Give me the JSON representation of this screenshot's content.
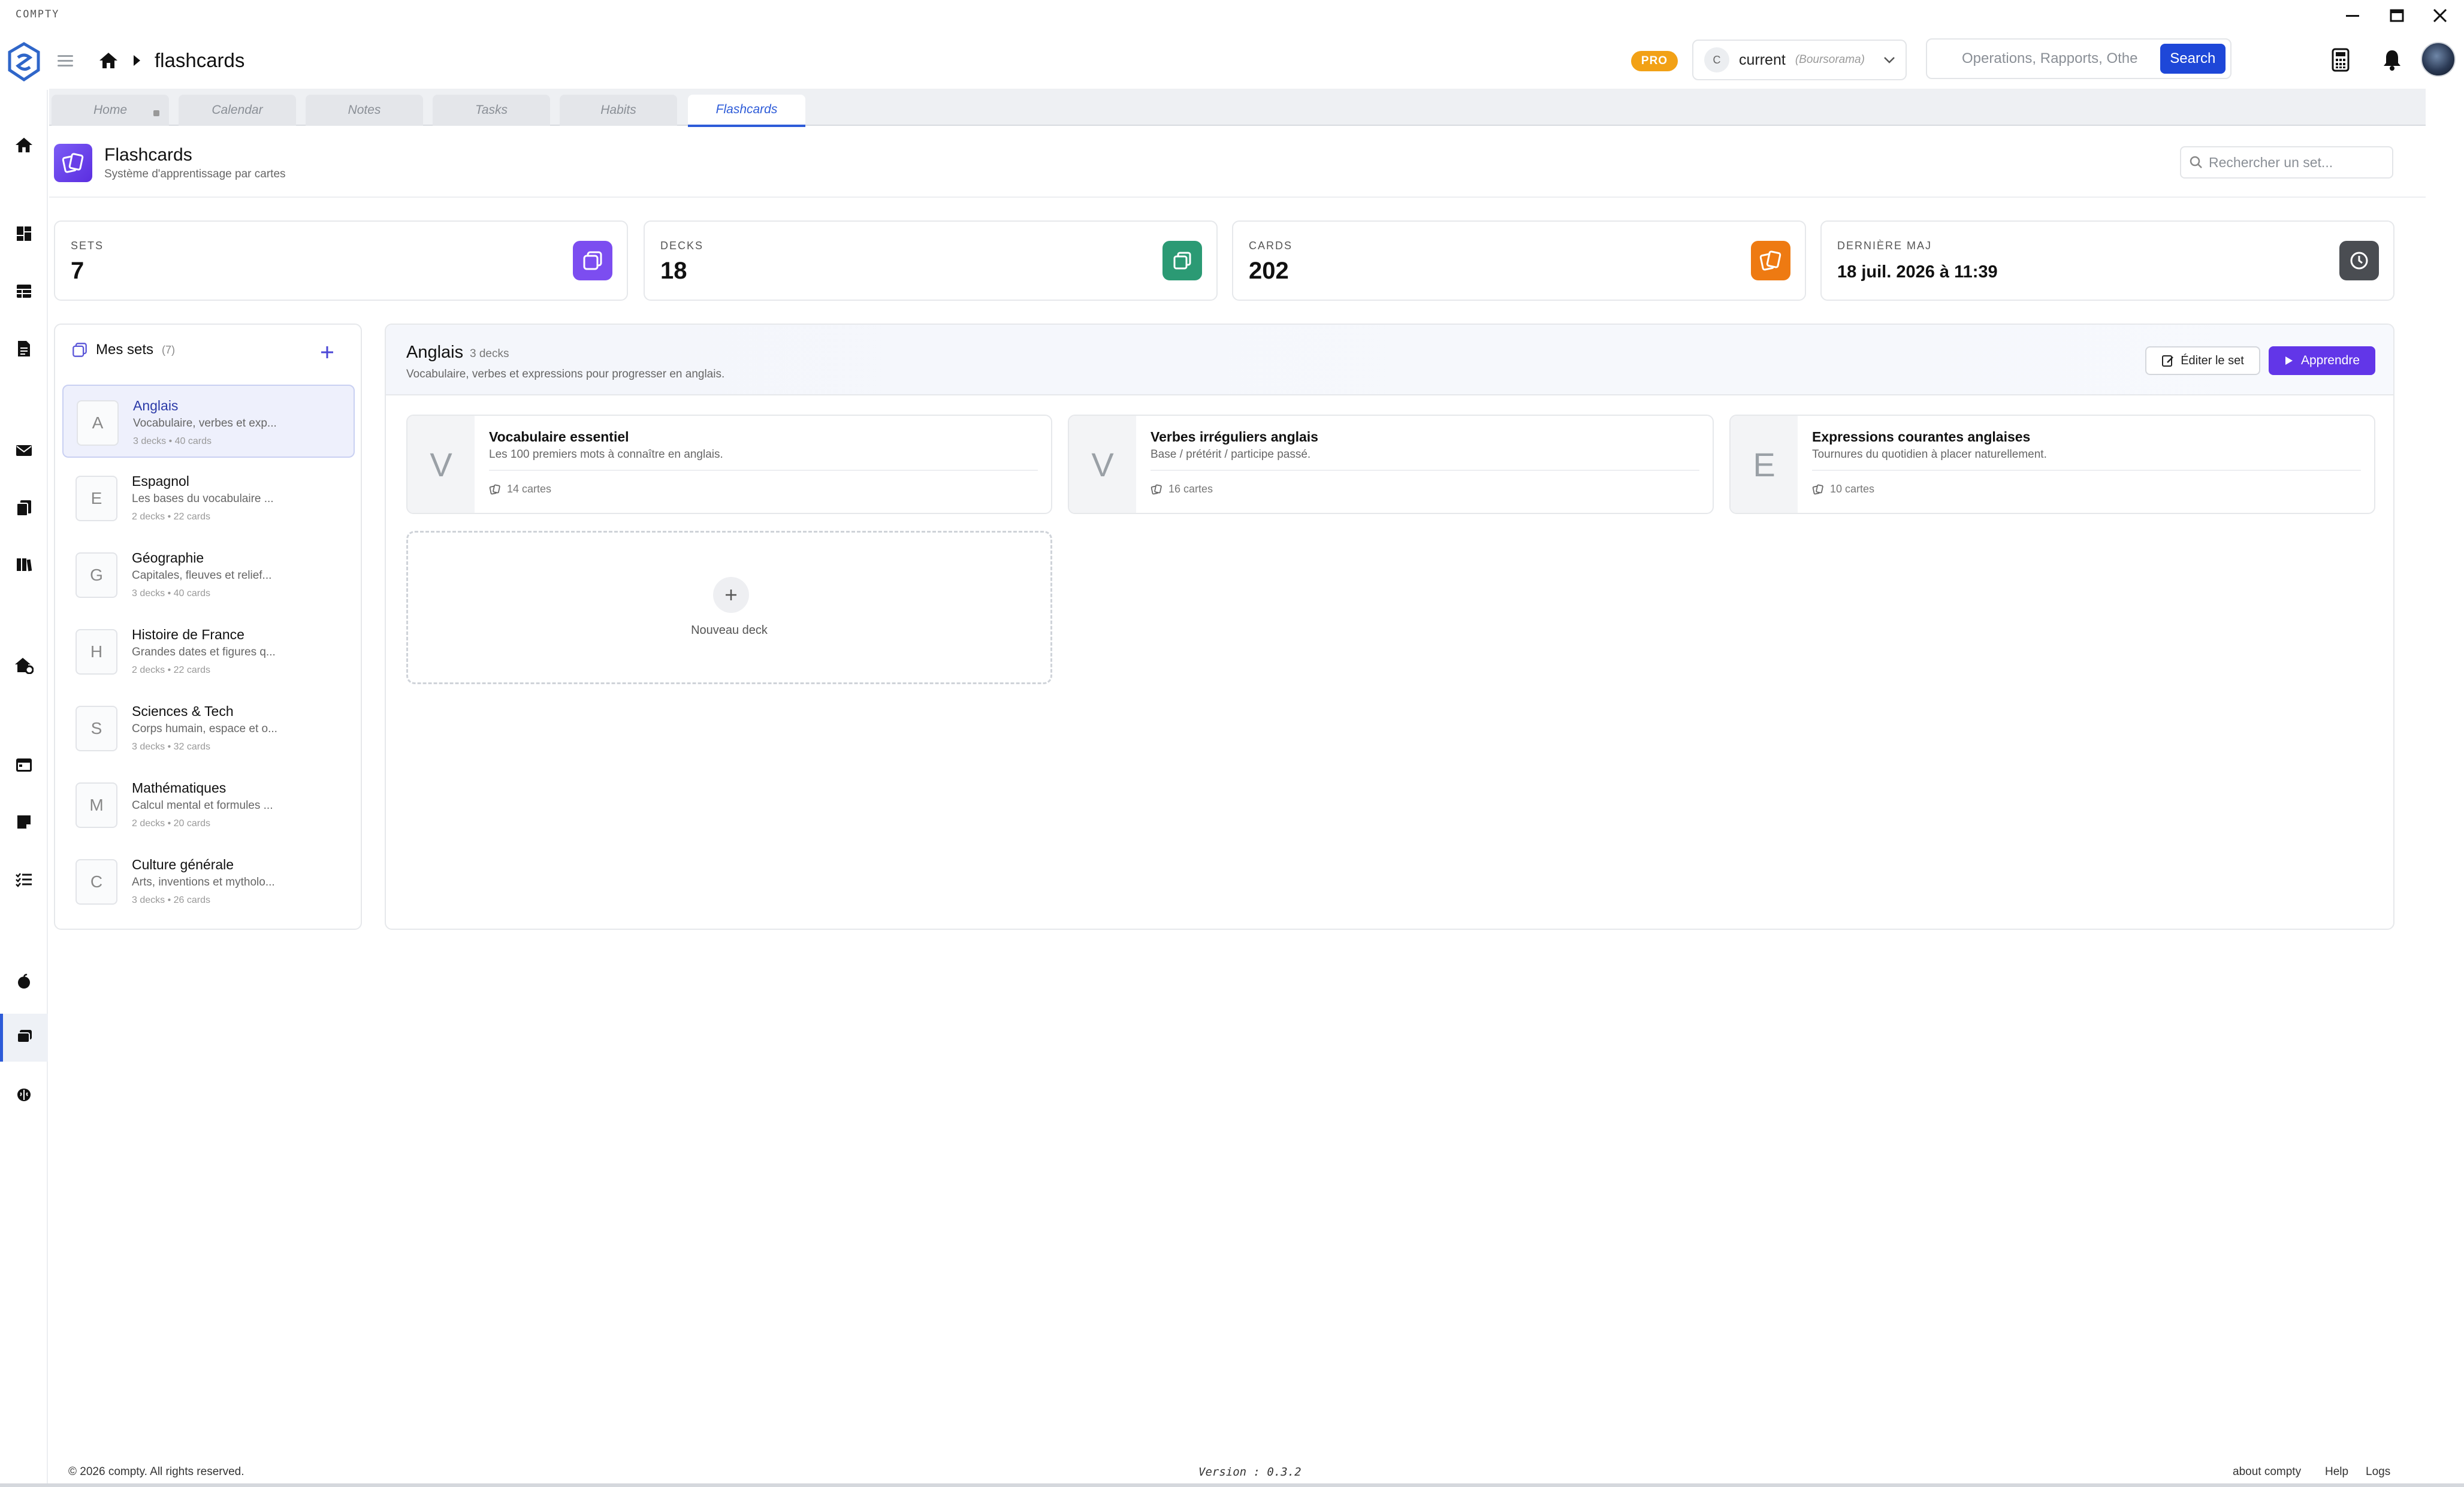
{
  "app": {
    "name": "COMPTY"
  },
  "header": {
    "breadcrumb_page": "flashcards",
    "pro_badge": "PRO",
    "account": {
      "initial": "C",
      "name": "current",
      "bank": "(Boursorama)"
    },
    "search": {
      "placeholder": "Operations, Rapports, Othe",
      "button": "Search"
    }
  },
  "tabs": [
    {
      "label": "Home"
    },
    {
      "label": "Calendar"
    },
    {
      "label": "Notes"
    },
    {
      "label": "Tasks"
    },
    {
      "label": "Habits"
    },
    {
      "label": "Flashcards",
      "active": true
    }
  ],
  "page": {
    "title": "Flashcards",
    "subtitle": "Système d'apprentissage par cartes",
    "search_placeholder": "Rechercher un set..."
  },
  "stats": [
    {
      "label": "SETS",
      "value": "7",
      "color": "#7c4df0",
      "icon": "sets-icon"
    },
    {
      "label": "DECKS",
      "value": "18",
      "color": "#2b9a74",
      "icon": "decks-icon"
    },
    {
      "label": "CARDS",
      "value": "202",
      "color": "#ee7a12",
      "icon": "cards-icon"
    },
    {
      "label": "DERNIÈRE MAJ",
      "value": "18 juil. 2026 à 11:39",
      "color": "#4a4d52",
      "icon": "clock-icon"
    }
  ],
  "sets": {
    "title": "Mes sets",
    "count": "(7)",
    "items": [
      {
        "letter": "A",
        "name": "Anglais",
        "desc": "Vocabulaire, verbes et exp...",
        "meta": "3 decks  •  40 cards",
        "active": true
      },
      {
        "letter": "E",
        "name": "Espagnol",
        "desc": "Les bases du vocabulaire ...",
        "meta": "2 decks  •  22 cards"
      },
      {
        "letter": "G",
        "name": "Géographie",
        "desc": "Capitales, fleuves et relief...",
        "meta": "3 decks  •  40 cards"
      },
      {
        "letter": "H",
        "name": "Histoire de France",
        "desc": "Grandes dates et figures q...",
        "meta": "2 decks  •  22 cards"
      },
      {
        "letter": "S",
        "name": "Sciences & Tech",
        "desc": "Corps humain, espace et o...",
        "meta": "3 decks  •  32 cards"
      },
      {
        "letter": "M",
        "name": "Mathématiques",
        "desc": "Calcul mental et formules ...",
        "meta": "2 decks  •  20 cards"
      },
      {
        "letter": "C",
        "name": "Culture générale",
        "desc": "Arts, inventions et mytholo...",
        "meta": "3 decks  •  26 cards"
      }
    ]
  },
  "selected_set": {
    "title": "Anglais",
    "count": "3 decks",
    "desc": "Vocabulaire, verbes et expressions pour progresser en anglais.",
    "edit_button": "Éditer le set",
    "learn_button": "Apprendre",
    "decks": [
      {
        "letter": "V",
        "title": "Vocabulaire essentiel",
        "desc": "Les 100 premiers mots à connaître en anglais.",
        "cards": "14 cartes"
      },
      {
        "letter": "V",
        "title": "Verbes irréguliers anglais",
        "desc": "Base / prétérit / participe passé.",
        "cards": "16 cartes"
      },
      {
        "letter": "E",
        "title": "Expressions courantes anglaises",
        "desc": "Tournures du quotidien à placer naturellement.",
        "cards": "10 cartes"
      }
    ],
    "new_deck": "Nouveau deck"
  },
  "footer": {
    "copyright": "© 2026 compty. All rights reserved.",
    "version": "Version : 0.3.2",
    "links": [
      "about compty",
      "Help",
      "Logs"
    ]
  }
}
